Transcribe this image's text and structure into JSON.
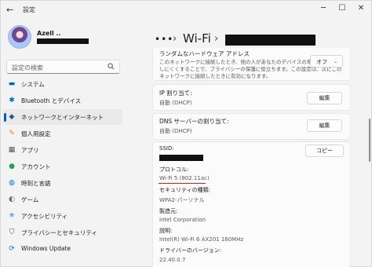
{
  "titlebar": {
    "back": "←",
    "title": "設定",
    "minimize": "─",
    "maximize": "☐",
    "close": "✕"
  },
  "profile": {
    "name": "Azell .."
  },
  "search": {
    "placeholder": "設定の検索"
  },
  "sidebar": {
    "items": [
      {
        "label": "システム",
        "icon": "monitor-icon",
        "glyph": "▬",
        "color": "#0067c0"
      },
      {
        "label": "Bluetooth とデバイス",
        "icon": "bluetooth-icon",
        "glyph": "✱",
        "color": "#0067c0"
      },
      {
        "label": "ネットワークとインターネット",
        "icon": "network-icon",
        "glyph": "◆",
        "color": "#2b579a",
        "active": true
      },
      {
        "label": "個人用設定",
        "icon": "brush-icon",
        "glyph": "✎",
        "color": "#d08a2b"
      },
      {
        "label": "アプリ",
        "icon": "apps-icon",
        "glyph": "▦",
        "color": "#555555"
      },
      {
        "label": "アカウント",
        "icon": "account-icon",
        "glyph": "●",
        "color": "#2e9d5c"
      },
      {
        "label": "時刻と言語",
        "icon": "globe-icon",
        "glyph": "◍",
        "color": "#0078d4"
      },
      {
        "label": "ゲーム",
        "icon": "gamepad-icon",
        "glyph": "◐",
        "color": "#6b6b6b"
      },
      {
        "label": "アクセシビリティ",
        "icon": "accessibility-icon",
        "glyph": "✳",
        "color": "#1f6fd0"
      },
      {
        "label": "プライバシーとセキュリティ",
        "icon": "shield-icon",
        "glyph": "⛉",
        "color": "#555555"
      },
      {
        "label": "Windows Update",
        "icon": "update-icon",
        "glyph": "⟳",
        "color": "#0078d4"
      }
    ]
  },
  "header": {
    "dots": "•••",
    "sep": "›",
    "title": "Wi-Fi"
  },
  "random_mac": {
    "title": "ランダムなハードウェア アドレス",
    "desc": [
      "このネットワークに接続したとき、他の人があなたのデバイスの場所を追跡",
      "しにくくすることで、プライバシーの保護に役立ちます。この設定は、次にこの",
      "ネットワークに接続したときに有効になります。"
    ],
    "value": "オフ"
  },
  "ip": {
    "title": "IP 割り当て:",
    "value": "自動 (DHCP)",
    "button": "編集"
  },
  "dns": {
    "title": "DNS サーバーの割り当て:",
    "value": "自動 (DHCP)",
    "button": "編集"
  },
  "properties": {
    "ssid_label": "SSID:",
    "copy_button": "コピー",
    "protocol_label": "プロトコル:",
    "protocol_value": "Wi-Fi 5 (802.11ac)",
    "security_label": "セキュリティの種類:",
    "security_value": "WPA2-パーソナル",
    "manufacturer_label": "製造元:",
    "manufacturer_value": "Intel Corporation",
    "description_label": "説明:",
    "description_value": "Intel(R) Wi-Fi 6 AX201 160MHz",
    "driver_label": "ドライバーのバージョン:",
    "driver_value": "22.40.0.7"
  }
}
